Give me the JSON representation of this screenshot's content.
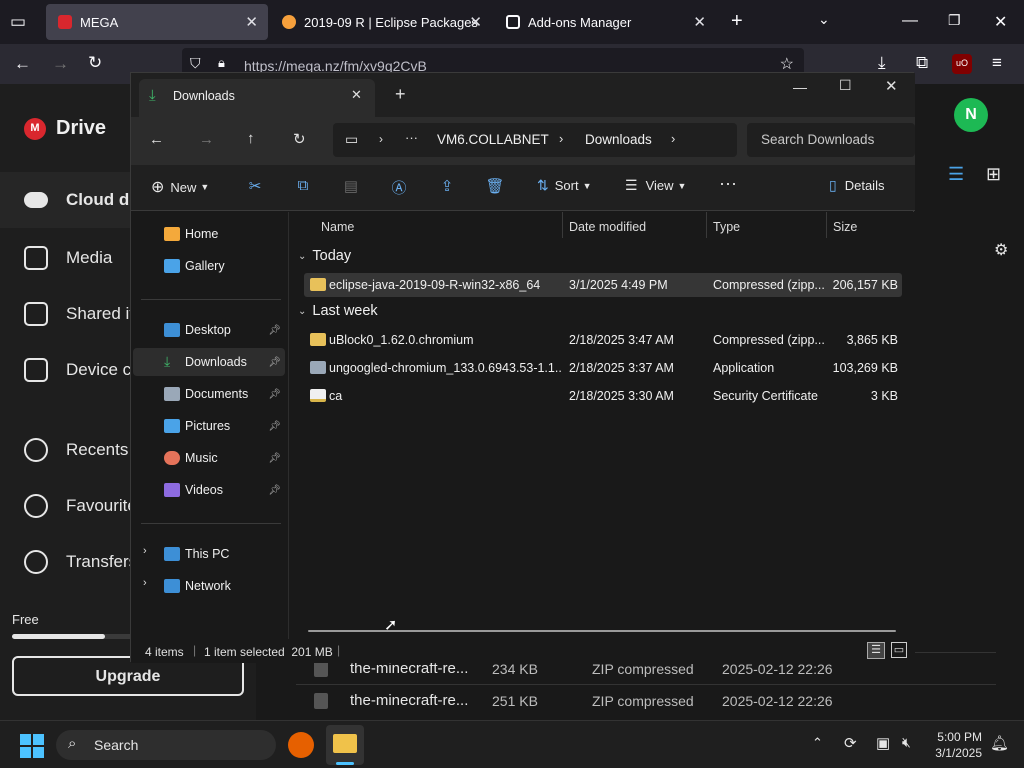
{
  "browser": {
    "tabs": [
      {
        "label": "MEGA",
        "active": true
      },
      {
        "label": "2019-09 R | Eclipse Packages",
        "active": false
      },
      {
        "label": "Add-ons Manager",
        "active": false
      }
    ],
    "url": "https://mega.nz/fm/xv9q2CvB",
    "ext_badge": "uO"
  },
  "mega": {
    "brand": "Drive",
    "avatar_initial": "N",
    "nav": [
      "Cloud drive",
      "Media",
      "Shared items",
      "Device centre",
      "Recents",
      "Favourites",
      "Transfers"
    ],
    "storage_label": "Free",
    "upgrade_label": "Upgrade",
    "rows": [
      {
        "name": "the-minecraft-re...",
        "size": "234 KB",
        "type": "ZIP compressed",
        "date": "2025-02-12 22:26"
      },
      {
        "name": "the-minecraft-re...",
        "size": "251 KB",
        "type": "ZIP compressed",
        "date": "2025-02-12 22:26"
      }
    ]
  },
  "explorer": {
    "tab_title": "Downloads",
    "breadcrumb": [
      "VM6.COLLABNET",
      "Downloads"
    ],
    "search_placeholder": "Search Downloads",
    "toolbar": {
      "new": "New",
      "sort": "Sort",
      "view": "View",
      "details": "Details"
    },
    "nav": [
      {
        "label": "Home",
        "icon": "home-icon",
        "color": "#f4a93b"
      },
      {
        "label": "Gallery",
        "icon": "gallery-icon",
        "color": "#4aa3e8"
      },
      {
        "label": "Desktop",
        "icon": "desktop-icon",
        "color": "#3d8fd6",
        "pinned": true
      },
      {
        "label": "Downloads",
        "icon": "download-icon",
        "color": "#3fb86a",
        "pinned": true,
        "selected": true
      },
      {
        "label": "Documents",
        "icon": "documents-icon",
        "color": "#9aa8b8",
        "pinned": true
      },
      {
        "label": "Pictures",
        "icon": "pictures-icon",
        "color": "#4aa3e8",
        "pinned": true
      },
      {
        "label": "Music",
        "icon": "music-icon",
        "color": "#e5735a",
        "pinned": true
      },
      {
        "label": "Videos",
        "icon": "videos-icon",
        "color": "#8d6be0",
        "pinned": true
      },
      {
        "label": "This PC",
        "icon": "this-pc-icon",
        "color": "#3d8fd6"
      },
      {
        "label": "Network",
        "icon": "network-icon",
        "color": "#3d8fd6"
      }
    ],
    "columns": [
      "Name",
      "Date modified",
      "Type",
      "Size"
    ],
    "groups": [
      {
        "label": "Today",
        "files": [
          {
            "name": "eclipse-java-2019-09-R-win32-x86_64",
            "date": "3/1/2025 4:49 PM",
            "type": "Compressed (zipp...",
            "size": "206,157 KB",
            "icon": "zip-folder-icon",
            "selected": true
          }
        ]
      },
      {
        "label": "Last week",
        "files": [
          {
            "name": "uBlock0_1.62.0.chromium",
            "date": "2/18/2025 3:47 AM",
            "type": "Compressed (zipp...",
            "size": "3,865 KB",
            "icon": "zip-folder-icon"
          },
          {
            "name": "ungoogled-chromium_133.0.6943.53-1.1...",
            "date": "2/18/2025 3:37 AM",
            "type": "Application",
            "size": "103,269 KB",
            "icon": "application-icon"
          },
          {
            "name": "ca",
            "date": "2/18/2025 3:30 AM",
            "type": "Security Certificate",
            "size": "3 KB",
            "icon": "certificate-icon"
          }
        ]
      }
    ],
    "status": {
      "count": "4 items",
      "selection": "1 item selected  201 MB"
    }
  },
  "taskbar": {
    "search_label": "Search",
    "time": "5:00 PM",
    "date": "3/1/2025"
  }
}
